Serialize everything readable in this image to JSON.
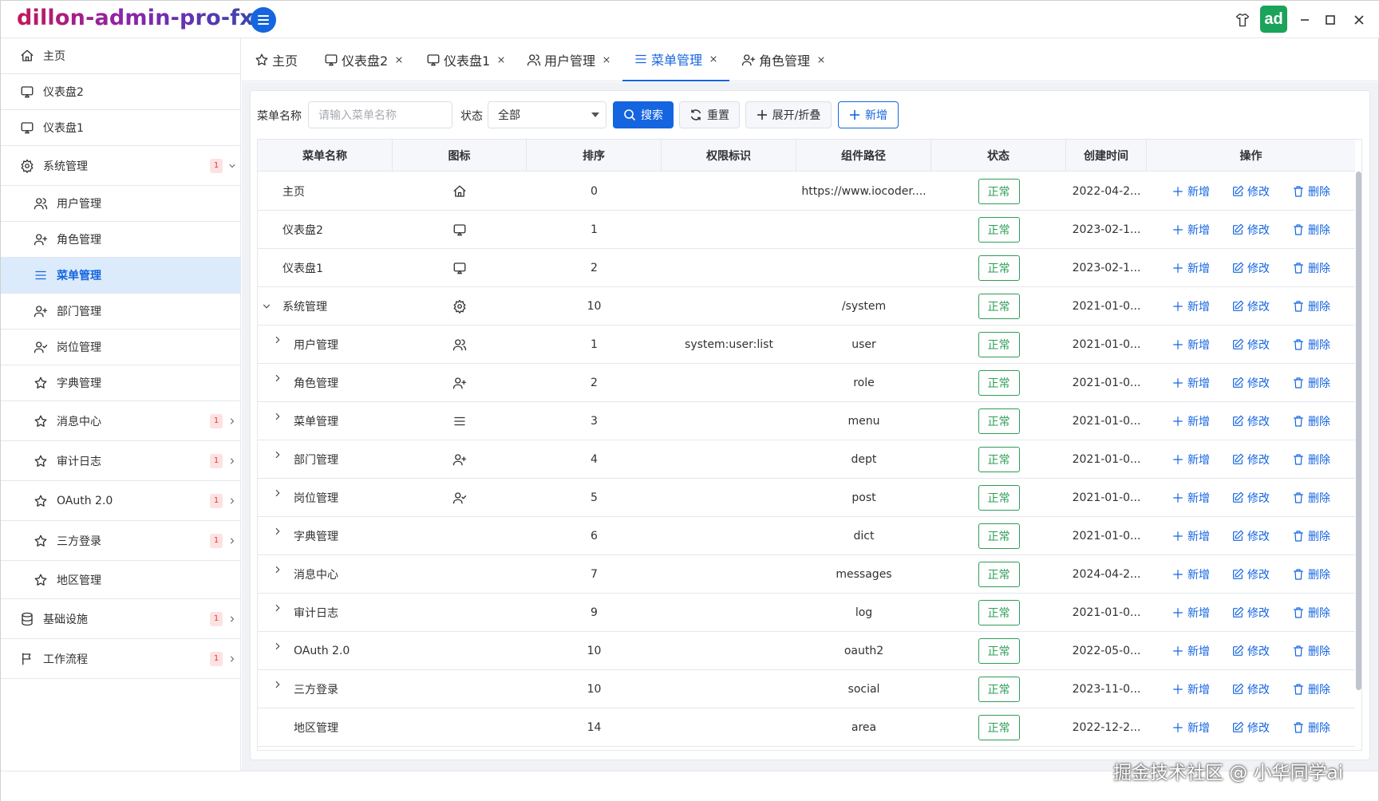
{
  "app": {
    "title": "dillon-admin-pro-fx",
    "avatar": "ad"
  },
  "colors": {
    "primary": "#1565e0",
    "success": "#2e9d57",
    "danger_badge": "#e53935",
    "active_bg": "#dcebfb"
  },
  "sidebar": {
    "items": [
      {
        "label": "主页",
        "icon": "home-icon"
      },
      {
        "label": "仪表盘2",
        "icon": "monitor-icon"
      },
      {
        "label": "仪表盘1",
        "icon": "monitor-icon"
      },
      {
        "label": "系统管理",
        "icon": "gear-icon",
        "badge": "1",
        "expanded": true
      },
      {
        "label": "用户管理",
        "icon": "users-icon"
      },
      {
        "label": "角色管理",
        "icon": "user-plus-icon"
      },
      {
        "label": "菜单管理",
        "icon": "menu-icon",
        "active": true
      },
      {
        "label": "部门管理",
        "icon": "user-plus-icon"
      },
      {
        "label": "岗位管理",
        "icon": "user-check-icon"
      },
      {
        "label": "字典管理",
        "icon": "star-icon"
      },
      {
        "label": "消息中心",
        "icon": "star-icon",
        "badge": "1"
      },
      {
        "label": "审计日志",
        "icon": "star-icon",
        "badge": "1"
      },
      {
        "label": "OAuth 2.0",
        "icon": "star-icon",
        "badge": "1"
      },
      {
        "label": "三方登录",
        "icon": "star-icon",
        "badge": "1"
      },
      {
        "label": "地区管理",
        "icon": "star-icon"
      },
      {
        "label": "基础设施",
        "icon": "database-icon",
        "badge": "1"
      },
      {
        "label": "工作流程",
        "icon": "flag-icon",
        "badge": "1"
      }
    ]
  },
  "tabs": [
    {
      "label": "主页",
      "icon": "star-icon",
      "closable": false
    },
    {
      "label": "仪表盘2",
      "icon": "monitor-icon",
      "closable": true
    },
    {
      "label": "仪表盘1",
      "icon": "monitor-icon",
      "closable": true
    },
    {
      "label": "用户管理",
      "icon": "users-icon",
      "closable": true
    },
    {
      "label": "菜单管理",
      "icon": "menu-icon",
      "closable": true,
      "active": true
    },
    {
      "label": "角色管理",
      "icon": "user-plus-icon",
      "closable": true
    }
  ],
  "filter": {
    "name_label": "菜单名称",
    "name_placeholder": "请输入菜单名称",
    "status_label": "状态",
    "status_value": "全部",
    "search_button": "搜索",
    "reset_button": "重置",
    "expand_button": "展开/折叠",
    "add_button": "新增"
  },
  "table": {
    "columns": [
      "菜单名称",
      "图标",
      "排序",
      "权限标识",
      "组件路径",
      "状态",
      "创建时间",
      "操作"
    ],
    "actions": {
      "add": "新增",
      "edit": "修改",
      "delete": "删除"
    },
    "rows": [
      {
        "name": "主页",
        "icon": "home-icon",
        "sort": "0",
        "perm": "",
        "path": "https://www.iocoder....",
        "status": "正常",
        "created": "2022-04-2...",
        "expander": "none",
        "indent": 0
      },
      {
        "name": "仪表盘2",
        "icon": "monitor-icon",
        "sort": "1",
        "perm": "",
        "path": "",
        "status": "正常",
        "created": "2023-02-1...",
        "expander": "none",
        "indent": 0
      },
      {
        "name": "仪表盘1",
        "icon": "monitor-icon",
        "sort": "2",
        "perm": "",
        "path": "",
        "status": "正常",
        "created": "2023-02-1...",
        "expander": "none",
        "indent": 0
      },
      {
        "name": "系统管理",
        "icon": "gear-icon",
        "sort": "10",
        "perm": "",
        "path": "/system",
        "status": "正常",
        "created": "2021-01-0...",
        "expander": "down",
        "indent": 0
      },
      {
        "name": "用户管理",
        "icon": "users-icon",
        "sort": "1",
        "perm": "system:user:list",
        "path": "user",
        "status": "正常",
        "created": "2021-01-0...",
        "expander": "right",
        "indent": 1
      },
      {
        "name": "角色管理",
        "icon": "user-plus-icon",
        "sort": "2",
        "perm": "",
        "path": "role",
        "status": "正常",
        "created": "2021-01-0...",
        "expander": "right",
        "indent": 1
      },
      {
        "name": "菜单管理",
        "icon": "menu-icon",
        "sort": "3",
        "perm": "",
        "path": "menu",
        "status": "正常",
        "created": "2021-01-0...",
        "expander": "right",
        "indent": 1
      },
      {
        "name": "部门管理",
        "icon": "user-plus-icon",
        "sort": "4",
        "perm": "",
        "path": "dept",
        "status": "正常",
        "created": "2021-01-0...",
        "expander": "right",
        "indent": 1
      },
      {
        "name": "岗位管理",
        "icon": "user-check-icon",
        "sort": "5",
        "perm": "",
        "path": "post",
        "status": "正常",
        "created": "2021-01-0...",
        "expander": "right",
        "indent": 1
      },
      {
        "name": "字典管理",
        "icon": "",
        "sort": "6",
        "perm": "",
        "path": "dict",
        "status": "正常",
        "created": "2021-01-0...",
        "expander": "right",
        "indent": 1
      },
      {
        "name": "消息中心",
        "icon": "",
        "sort": "7",
        "perm": "",
        "path": "messages",
        "status": "正常",
        "created": "2024-04-2...",
        "expander": "right",
        "indent": 1
      },
      {
        "name": "审计日志",
        "icon": "",
        "sort": "9",
        "perm": "",
        "path": "log",
        "status": "正常",
        "created": "2021-01-0...",
        "expander": "right",
        "indent": 1
      },
      {
        "name": "OAuth 2.0",
        "icon": "",
        "sort": "10",
        "perm": "",
        "path": "oauth2",
        "status": "正常",
        "created": "2022-05-0...",
        "expander": "right",
        "indent": 1
      },
      {
        "name": "三方登录",
        "icon": "",
        "sort": "10",
        "perm": "",
        "path": "social",
        "status": "正常",
        "created": "2023-11-0...",
        "expander": "right",
        "indent": 1
      },
      {
        "name": "地区管理",
        "icon": "",
        "sort": "14",
        "perm": "",
        "path": "area",
        "status": "正常",
        "created": "2022-12-2...",
        "expander": "none",
        "indent": 1
      }
    ]
  },
  "watermark": "掘金技术社区 @ 小华同学ai"
}
